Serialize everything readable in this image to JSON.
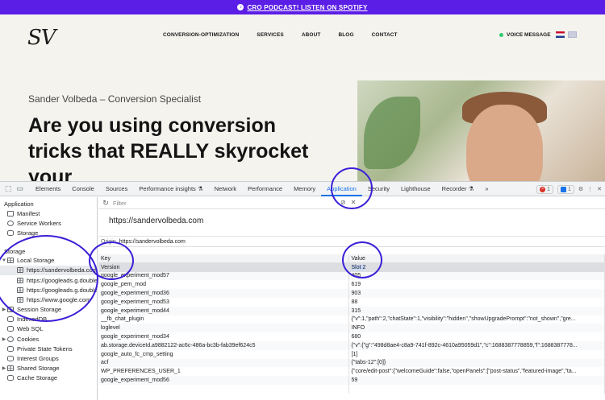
{
  "promo": {
    "icon": "spotify-icon",
    "text": "CRO PODCAST! LISTEN ON SPOTIFY"
  },
  "site": {
    "logo": "SV",
    "nav": [
      "CONVERSION-OPTIMIZATION",
      "SERVICES",
      "ABOUT",
      "BLOG",
      "CONTACT"
    ],
    "voice": "VOICE MESSAGE",
    "subtitle": "Sander Volbeda – Conversion Specialist",
    "headline": "Are you using conversion tricks that REALLY skyrocket your"
  },
  "devtools": {
    "tabs": [
      "Elements",
      "Console",
      "Sources",
      "Performance insights ⚗",
      "Network",
      "Performance",
      "Memory",
      "Application",
      "Security",
      "Lighthouse",
      "Recorder ⚗",
      "»"
    ],
    "active_tab": "Application",
    "errors": "1",
    "issues": "1",
    "sidebar": {
      "application_header": "Application",
      "application_items": [
        "Manifest",
        "Service Workers",
        "Storage"
      ],
      "storage_header": "Storage",
      "local_storage": "Local Storage",
      "local_storage_items": [
        "https://sandervolbeda.com",
        "https://googleads.g.doubleclick.net",
        "https://googleads.g.doubleclick.net",
        "https://www.google.com"
      ],
      "storage_items": [
        "Session Storage",
        "IndexedDB",
        "Web SQL",
        "Cookies",
        "Private State Tokens",
        "Interest Groups",
        "Shared Storage",
        "Cache Storage"
      ]
    },
    "filter_placeholder": "Filter",
    "origin_title": "https://sandervolbeda.com",
    "origin_label": "Origin",
    "origin_value": "https://sandervolbeda.com",
    "table": {
      "headers": [
        "Key",
        "Value"
      ],
      "rows": [
        [
          "Version",
          "Slot 2"
        ],
        [
          "google_experiment_mod57",
          "405"
        ],
        [
          "google_pem_mod",
          "619"
        ],
        [
          "google_experiment_mod36",
          "903"
        ],
        [
          "google_experiment_mod53",
          "88"
        ],
        [
          "google_experiment_mod44",
          "315"
        ],
        [
          "__fb_chat_plugin",
          "{\"v\":1,\"path\":2,\"chatState\":1,\"visibility\":\"hidden\",\"showUpgradePrompt\":\"not_shown\",\"gre..."
        ],
        [
          "loglevel",
          "INFO"
        ],
        [
          "google_experiment_mod34",
          "680"
        ],
        [
          "ab.storage.deviceId.a9882122-ac6c-486a-bc3b-fab39ef624c5",
          "{\"v\":{\"g\":\"498d8ae4-c8a9-741f-892c-4610a95059d1\",\"c\":1688387778859,\"l\":1688387778..."
        ],
        [
          "google_auto_fc_cmp_setting",
          "[1]"
        ],
        [
          "acf",
          "{\"tabs-12\":[0]}"
        ],
        [
          "WP_PREFERENCES_USER_1",
          "{\"core/edit-post\":{\"welcomeGuide\":false,\"openPanels\":[\"post-status\",\"featured-image\",\"ta..."
        ],
        [
          "google_experiment_mod56",
          "59"
        ],
        [
          "",
          ""
        ]
      ]
    }
  }
}
